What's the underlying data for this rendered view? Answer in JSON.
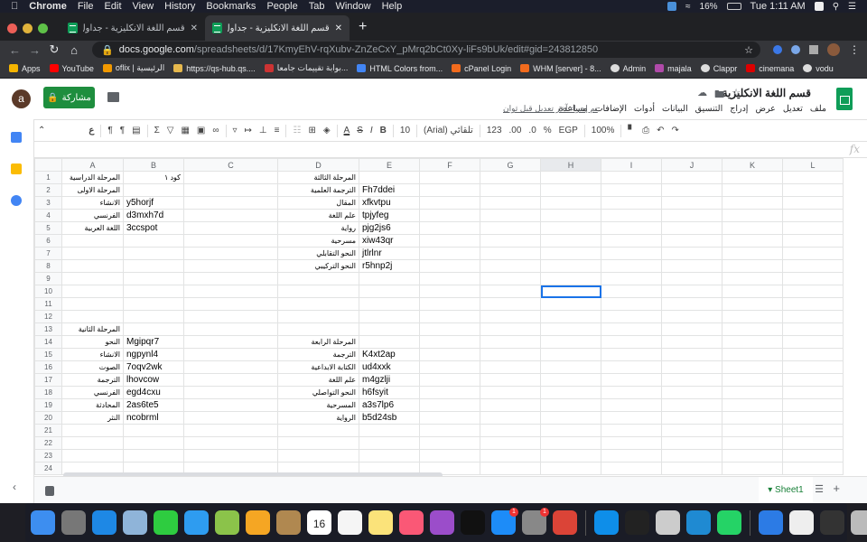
{
  "macos_menubar": {
    "app": "Chrome",
    "items": [
      "File",
      "Edit",
      "View",
      "History",
      "Bookmarks",
      "People",
      "Tab",
      "Window",
      "Help"
    ],
    "battery": "16%",
    "clock": "Tue 1:11 AM"
  },
  "browser": {
    "tabs": [
      {
        "title": "قسم اللغة الانكليزية - جداول بيانات",
        "active": false
      },
      {
        "title": "قسم اللغة الانكليزية - جداول بيانات",
        "active": true
      }
    ],
    "url_host": "docs.google.com",
    "url_path": "/spreadsheets/d/17KmyEhV-rqXubv-ZnZeCxY_pMrq2bCt0Xy-liFs9bUk/edit#gid=243812850",
    "bookmarks": [
      {
        "label": "Apps",
        "color": "#f4b400"
      },
      {
        "label": "YouTube",
        "color": "#ff0000"
      },
      {
        "label": "oflix | الرئيسية",
        "color": "#f29900"
      },
      {
        "label": "https://qs-hub.qs....",
        "color": "#e6b84d"
      },
      {
        "label": "بوابة تقييمات جامعا...",
        "color": "#c33"
      },
      {
        "label": "HTML Colors from...",
        "color": "#4285f4"
      },
      {
        "label": "cPanel Login",
        "color": "#f26b1d"
      },
      {
        "label": "WHM [server] - 8...",
        "color": "#f26b1d"
      },
      {
        "label": "Admin",
        "color": "#ddd"
      },
      {
        "label": "majala",
        "color": "#b04aa9"
      },
      {
        "label": "Clappr",
        "color": "#ddd"
      },
      {
        "label": "cinemana",
        "color": "#d00"
      },
      {
        "label": "vodu",
        "color": "#ddd"
      }
    ]
  },
  "sheets": {
    "doc_title": "قسم اللغة الانكليزية",
    "avatar_letter": "a",
    "share_label": "مشاركة",
    "menus": [
      "ملف",
      "تعديل",
      "عرض",
      "إدراج",
      "التنسيق",
      "البيانات",
      "أدوات",
      "الإضافات",
      "مساعدة"
    ],
    "last_edit": "تم إجراء آخر تعديل قبل ثوان",
    "toolbar": {
      "zoom": "100%",
      "currency": "EGP",
      "percent": "%",
      "decrease_decimal": ".0",
      "increase_decimal": ".00",
      "number_format": "123",
      "font": "تلقائي (Arial)",
      "font_size": "10",
      "bold": "B",
      "italic": "I",
      "strike": "S",
      "text_color": "A",
      "sum": "Σ",
      "input_tools": "ع"
    },
    "fx_label": "fx",
    "columns": [
      "A",
      "B",
      "C",
      "D",
      "E",
      "F",
      "G",
      "H",
      "I",
      "J",
      "K",
      "L"
    ],
    "selected_cell": "H10",
    "rows": [
      {
        "n": "1",
        "A": "المرحلة الدراسية",
        "B": "كود ١",
        "D": "المرحلة الثالثة",
        "E": ""
      },
      {
        "n": "2",
        "A": "المرحلة الاولى",
        "B": "",
        "D": "الترجمة العلمية",
        "E": "Fh7ddei"
      },
      {
        "n": "3",
        "A": "الانشاء",
        "B": "y5horjf",
        "D": "المقال",
        "E": "xfkvtpu"
      },
      {
        "n": "4",
        "A": "الفرنسي",
        "B": "d3mxh7d",
        "D": "علم اللغة",
        "E": "tpjyfeg"
      },
      {
        "n": "5",
        "A": "اللغة العربية",
        "B": "3ccspot",
        "D": "رواية",
        "E": "pjg2js6"
      },
      {
        "n": "6",
        "A": "",
        "B": "",
        "D": "مسرحية",
        "E": "xiw43qr"
      },
      {
        "n": "7",
        "A": "",
        "B": "",
        "D": "النحو التقابلي",
        "E": "jtlrlnr"
      },
      {
        "n": "8",
        "A": "",
        "B": "",
        "D": "النحو التركيبي",
        "E": "r5hnp2j"
      },
      {
        "n": "9",
        "A": "",
        "B": "",
        "D": "",
        "E": ""
      },
      {
        "n": "10",
        "A": "",
        "B": "",
        "D": "",
        "E": ""
      },
      {
        "n": "11",
        "A": "",
        "B": "",
        "D": "",
        "E": ""
      },
      {
        "n": "12",
        "A": "",
        "B": "",
        "D": "",
        "E": ""
      },
      {
        "n": "13",
        "A": "المرحلة الثانية",
        "B": "",
        "D": "",
        "E": ""
      },
      {
        "n": "14",
        "A": "النحو",
        "B": "Mgipqr7",
        "D": "المرحلة الرابعة",
        "E": ""
      },
      {
        "n": "15",
        "A": "الانشاء",
        "B": "ngpynl4",
        "D": "الترجمة",
        "E": "K4xt2ap"
      },
      {
        "n": "16",
        "A": "الصوت",
        "B": "7oqv2wk",
        "D": "الكتابة الابداعية",
        "E": "ud4xxk"
      },
      {
        "n": "17",
        "A": "الترجمة",
        "B": "lhovcow",
        "D": "علم اللغة",
        "E": "m4gzlji"
      },
      {
        "n": "18",
        "A": "الفرنسي",
        "B": "egd4cxu",
        "D": "النحو التواصلي",
        "E": "h6fsyit"
      },
      {
        "n": "19",
        "A": "المحادثة",
        "B": "2as6te5",
        "D": "المسرحية",
        "E": "a3s7lp6"
      },
      {
        "n": "20",
        "A": "النثر",
        "B": "ncobrml",
        "D": "الرواية",
        "E": "b5d24sb"
      },
      {
        "n": "21",
        "A": "",
        "B": "",
        "D": "",
        "E": ""
      },
      {
        "n": "22",
        "A": "",
        "B": "",
        "D": "",
        "E": ""
      },
      {
        "n": "23",
        "A": "",
        "B": "",
        "D": "",
        "E": ""
      },
      {
        "n": "24",
        "A": "",
        "B": "",
        "D": "",
        "E": ""
      }
    ],
    "sheet_tab": "Sheet1"
  },
  "dock": {
    "apps": [
      {
        "name": "finder",
        "color": "#3d8ef0"
      },
      {
        "name": "launchpad",
        "color": "#777"
      },
      {
        "name": "safari",
        "color": "#1e88e5"
      },
      {
        "name": "preview",
        "color": "#8fb4d9"
      },
      {
        "name": "facetime",
        "color": "#2ecc40"
      },
      {
        "name": "messages",
        "color": "#2e9cf0"
      },
      {
        "name": "maps",
        "color": "#8bc34a"
      },
      {
        "name": "photos",
        "color": "#f5a623"
      },
      {
        "name": "contacts",
        "color": "#b08850"
      },
      {
        "name": "calendar",
        "color": "#ffffff",
        "label": "16"
      },
      {
        "name": "reminders",
        "color": "#f5f5f5"
      },
      {
        "name": "notes",
        "color": "#fbe37a"
      },
      {
        "name": "music",
        "color": "#fa5876"
      },
      {
        "name": "podcasts",
        "color": "#9b4dca"
      },
      {
        "name": "tv",
        "color": "#111"
      },
      {
        "name": "app-store",
        "color": "#1d8cf8",
        "badge": "1"
      },
      {
        "name": "system-preferences",
        "color": "#888",
        "badge": "1"
      },
      {
        "name": "chrome",
        "color": "#db4437"
      },
      {
        "name": "teamviewer",
        "color": "#0e8ee9"
      },
      {
        "name": "terminal",
        "color": "#222"
      },
      {
        "name": "settings-utility",
        "color": "#ccc"
      },
      {
        "name": "vscode",
        "color": "#1f8ad2"
      },
      {
        "name": "whatsapp",
        "color": "#25d366"
      },
      {
        "name": "network",
        "color": "#2c7be5"
      },
      {
        "name": "screenshot-window",
        "color": "#eee"
      },
      {
        "name": "document-stack",
        "color": "#333"
      },
      {
        "name": "trash",
        "color": "#bbb"
      }
    ]
  }
}
